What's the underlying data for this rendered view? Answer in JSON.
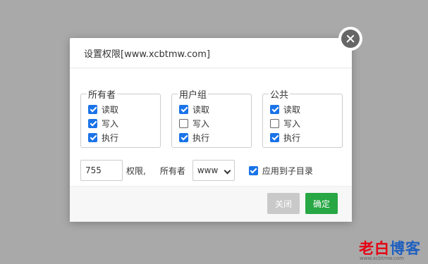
{
  "dialog": {
    "title": "设置权限[www.xcbtmw.com]"
  },
  "groups": {
    "owner": {
      "title": "所有者",
      "items": [
        {
          "label": "读取",
          "checked": true
        },
        {
          "label": "写入",
          "checked": true
        },
        {
          "label": "执行",
          "checked": true
        }
      ]
    },
    "usergroup": {
      "title": "用户组",
      "items": [
        {
          "label": "读取",
          "checked": true
        },
        {
          "label": "写入",
          "checked": false
        },
        {
          "label": "执行",
          "checked": true
        }
      ]
    },
    "public": {
      "title": "公共",
      "items": [
        {
          "label": "读取",
          "checked": true
        },
        {
          "label": "写入",
          "checked": false
        },
        {
          "label": "执行",
          "checked": true
        }
      ]
    }
  },
  "permission": {
    "value": "755",
    "label": "权限,",
    "owner_label": "所有者",
    "owner_select": "www",
    "apply_sub_label": "应用到子目录",
    "apply_sub_checked": true
  },
  "buttons": {
    "close_label": "关闭",
    "ok_label": "确定"
  },
  "watermark": {
    "red": "老白",
    "blue": "博客",
    "sub": "www.xcbtmw.com"
  },
  "colors": {
    "checkbox": "#1a73e8",
    "ok_button": "#28a745",
    "close_button": "#c9c9c9",
    "overlay": "#a9a9a9"
  }
}
